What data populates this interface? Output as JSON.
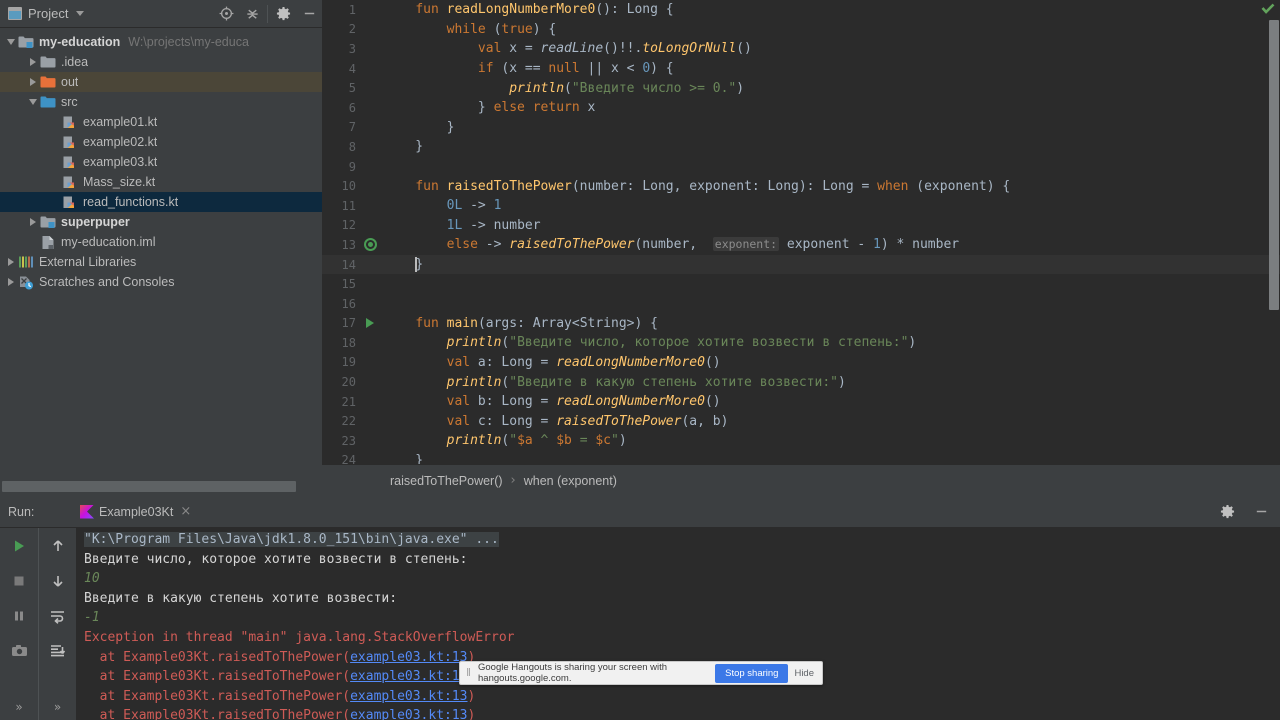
{
  "project_panel": {
    "title": "Project",
    "toolbar": [
      {
        "name": "locate-icon",
        "label": "Select Opened File"
      },
      {
        "name": "collapse-all-icon",
        "label": "Collapse All"
      },
      {
        "name": "gear-icon",
        "label": "Settings"
      },
      {
        "name": "minimize-icon",
        "label": "Hide"
      }
    ],
    "tree": [
      {
        "label": "my-education",
        "path": "W:\\projects\\my-educa",
        "indent": 0,
        "arrow": "down",
        "icon": "module-folder-icon",
        "bold": true,
        "state": "normal"
      },
      {
        "label": ".idea",
        "path": "",
        "indent": 1,
        "arrow": "right",
        "icon": "folder-icon-grey",
        "bold": false,
        "state": "normal"
      },
      {
        "label": "out",
        "path": "",
        "indent": 1,
        "arrow": "right",
        "icon": "folder-icon-orange",
        "bold": false,
        "state": "highlight"
      },
      {
        "label": "src",
        "path": "",
        "indent": 1,
        "arrow": "down",
        "icon": "folder-icon-blue",
        "bold": false,
        "state": "normal"
      },
      {
        "label": "example01.kt",
        "path": "",
        "indent": 2,
        "arrow": "none",
        "icon": "kotlin-file-icon",
        "bold": false,
        "state": "normal"
      },
      {
        "label": "example02.kt",
        "path": "",
        "indent": 2,
        "arrow": "none",
        "icon": "kotlin-file-icon",
        "bold": false,
        "state": "normal"
      },
      {
        "label": "example03.kt",
        "path": "",
        "indent": 2,
        "arrow": "none",
        "icon": "kotlin-file-icon",
        "bold": false,
        "state": "normal"
      },
      {
        "label": "Mass_size.kt",
        "path": "",
        "indent": 2,
        "arrow": "none",
        "icon": "kotlin-file-icon",
        "bold": false,
        "state": "normal"
      },
      {
        "label": "read_functions.kt",
        "path": "",
        "indent": 2,
        "arrow": "none",
        "icon": "kotlin-file-icon",
        "bold": false,
        "state": "selected"
      },
      {
        "label": "superpuper",
        "path": "",
        "indent": 1,
        "arrow": "right",
        "icon": "module-folder-icon",
        "bold": true,
        "state": "normal"
      },
      {
        "label": "my-education.iml",
        "path": "",
        "indent": 1,
        "arrow": "none",
        "icon": "iml-file-icon",
        "bold": false,
        "state": "normal"
      },
      {
        "label": "External Libraries",
        "path": "",
        "indent": 0,
        "arrow": "right",
        "icon": "libraries-icon",
        "bold": false,
        "state": "normal"
      },
      {
        "label": "Scratches and Consoles",
        "path": "",
        "indent": 0,
        "arrow": "right",
        "icon": "scratches-icon",
        "bold": false,
        "state": "normal"
      }
    ]
  },
  "editor": {
    "inspection_status": "ok-check-icon",
    "breadcrumb": [
      "raisedToThePower()",
      "when (exponent)"
    ],
    "breadcrumb_separator": "›",
    "lines": [
      {
        "n": "1",
        "gutter": "",
        "tokens": [
          {
            "t": "    ",
            "c": "pun"
          },
          {
            "t": "fun ",
            "c": "kw"
          },
          {
            "t": "readLongNumberMore0",
            "c": "fn"
          },
          {
            "t": "(): ",
            "c": "pun"
          },
          {
            "t": "Long",
            "c": "typ"
          },
          {
            "t": " {",
            "c": "pun"
          }
        ]
      },
      {
        "n": "2",
        "gutter": "",
        "tokens": [
          {
            "t": "        ",
            "c": "pun"
          },
          {
            "t": "while",
            "c": "kw"
          },
          {
            "t": " (",
            "c": "pun"
          },
          {
            "t": "true",
            "c": "kw"
          },
          {
            "t": ") {",
            "c": "pun"
          }
        ]
      },
      {
        "n": "3",
        "gutter": "",
        "tokens": [
          {
            "t": "            ",
            "c": "pun"
          },
          {
            "t": "val",
            "c": "kw"
          },
          {
            "t": " x = ",
            "c": "id"
          },
          {
            "t": "readLine",
            "c": "idi"
          },
          {
            "t": "()!!.",
            "c": "pun"
          },
          {
            "t": "toLongOrNull",
            "c": "fni"
          },
          {
            "t": "()",
            "c": "pun"
          }
        ]
      },
      {
        "n": "4",
        "gutter": "",
        "tokens": [
          {
            "t": "            ",
            "c": "pun"
          },
          {
            "t": "if",
            "c": "kw"
          },
          {
            "t": " (x == ",
            "c": "id"
          },
          {
            "t": "null",
            "c": "kw"
          },
          {
            "t": " || x < ",
            "c": "id"
          },
          {
            "t": "0",
            "c": "num"
          },
          {
            "t": ") {",
            "c": "pun"
          }
        ]
      },
      {
        "n": "5",
        "gutter": "",
        "tokens": [
          {
            "t": "                ",
            "c": "pun"
          },
          {
            "t": "println",
            "c": "fni"
          },
          {
            "t": "(",
            "c": "pun"
          },
          {
            "t": "\"Введите число >= 0.\"",
            "c": "str"
          },
          {
            "t": ")",
            "c": "pun"
          }
        ]
      },
      {
        "n": "6",
        "gutter": "",
        "tokens": [
          {
            "t": "            } ",
            "c": "pun"
          },
          {
            "t": "else return",
            "c": "kw"
          },
          {
            "t": " x",
            "c": "id"
          }
        ]
      },
      {
        "n": "7",
        "gutter": "",
        "tokens": [
          {
            "t": "        }",
            "c": "pun"
          }
        ]
      },
      {
        "n": "8",
        "gutter": "",
        "tokens": [
          {
            "t": "    }",
            "c": "pun"
          }
        ]
      },
      {
        "n": "9",
        "gutter": "",
        "tokens": []
      },
      {
        "n": "10",
        "gutter": "",
        "tokens": [
          {
            "t": "    ",
            "c": "pun"
          },
          {
            "t": "fun ",
            "c": "kw"
          },
          {
            "t": "raisedToThePower",
            "c": "fn"
          },
          {
            "t": "(number: ",
            "c": "id"
          },
          {
            "t": "Long",
            "c": "typ"
          },
          {
            "t": ", exponent: ",
            "c": "id"
          },
          {
            "t": "Long",
            "c": "typ"
          },
          {
            "t": "): ",
            "c": "pun"
          },
          {
            "t": "Long",
            "c": "typ"
          },
          {
            "t": " = ",
            "c": "pun"
          },
          {
            "t": "when",
            "c": "kw"
          },
          {
            "t": " (exponent) {",
            "c": "id"
          }
        ]
      },
      {
        "n": "11",
        "gutter": "",
        "tokens": [
          {
            "t": "        ",
            "c": "pun"
          },
          {
            "t": "0L",
            "c": "num"
          },
          {
            "t": " -> ",
            "c": "pun"
          },
          {
            "t": "1",
            "c": "num"
          }
        ]
      },
      {
        "n": "12",
        "gutter": "",
        "tokens": [
          {
            "t": "        ",
            "c": "pun"
          },
          {
            "t": "1L",
            "c": "num"
          },
          {
            "t": " -> number",
            "c": "id"
          }
        ]
      },
      {
        "n": "13",
        "gutter": "recursion-icon",
        "tokens": [
          {
            "t": "        ",
            "c": "pun"
          },
          {
            "t": "else",
            "c": "kw"
          },
          {
            "t": " -> ",
            "c": "pun"
          },
          {
            "t": "raisedToThePower",
            "c": "fni"
          },
          {
            "t": "(number,  ",
            "c": "id"
          },
          {
            "t": "exponent:",
            "c": "hint"
          },
          {
            "t": " exponent - ",
            "c": "id"
          },
          {
            "t": "1",
            "c": "num"
          },
          {
            "t": ") * number",
            "c": "id"
          }
        ]
      },
      {
        "n": "14",
        "gutter": "",
        "tokens": [
          {
            "t": "    ",
            "c": "pun"
          },
          {
            "t": "CARET",
            "c": "caret"
          },
          {
            "t": "}",
            "c": "pun"
          }
        ],
        "current": true
      },
      {
        "n": "15",
        "gutter": "",
        "tokens": []
      },
      {
        "n": "16",
        "gutter": "",
        "tokens": []
      },
      {
        "n": "17",
        "gutter": "run-icon",
        "tokens": [
          {
            "t": "    ",
            "c": "pun"
          },
          {
            "t": "fun ",
            "c": "kw"
          },
          {
            "t": "main",
            "c": "fn"
          },
          {
            "t": "(args: ",
            "c": "id"
          },
          {
            "t": "Array",
            "c": "typ"
          },
          {
            "t": "<",
            "c": "pun"
          },
          {
            "t": "String",
            "c": "typ"
          },
          {
            "t": ">) {",
            "c": "pun"
          }
        ]
      },
      {
        "n": "18",
        "gutter": "",
        "tokens": [
          {
            "t": "        ",
            "c": "pun"
          },
          {
            "t": "println",
            "c": "fni"
          },
          {
            "t": "(",
            "c": "pun"
          },
          {
            "t": "\"Введите число, которое хотите возвести в степень:\"",
            "c": "str"
          },
          {
            "t": ")",
            "c": "pun"
          }
        ]
      },
      {
        "n": "19",
        "gutter": "",
        "tokens": [
          {
            "t": "        ",
            "c": "pun"
          },
          {
            "t": "val",
            "c": "kw"
          },
          {
            "t": " a: ",
            "c": "id"
          },
          {
            "t": "Long",
            "c": "typ"
          },
          {
            "t": " = ",
            "c": "pun"
          },
          {
            "t": "readLongNumberMore0",
            "c": "fni"
          },
          {
            "t": "()",
            "c": "pun"
          }
        ]
      },
      {
        "n": "20",
        "gutter": "",
        "tokens": [
          {
            "t": "        ",
            "c": "pun"
          },
          {
            "t": "println",
            "c": "fni"
          },
          {
            "t": "(",
            "c": "pun"
          },
          {
            "t": "\"Введите в какую степень хотите возвести:\"",
            "c": "str"
          },
          {
            "t": ")",
            "c": "pun"
          }
        ]
      },
      {
        "n": "21",
        "gutter": "",
        "tokens": [
          {
            "t": "        ",
            "c": "pun"
          },
          {
            "t": "val",
            "c": "kw"
          },
          {
            "t": " b: ",
            "c": "id"
          },
          {
            "t": "Long",
            "c": "typ"
          },
          {
            "t": " = ",
            "c": "pun"
          },
          {
            "t": "readLongNumberMore0",
            "c": "fni"
          },
          {
            "t": "()",
            "c": "pun"
          }
        ]
      },
      {
        "n": "22",
        "gutter": "",
        "tokens": [
          {
            "t": "        ",
            "c": "pun"
          },
          {
            "t": "val",
            "c": "kw"
          },
          {
            "t": " c: ",
            "c": "id"
          },
          {
            "t": "Long",
            "c": "typ"
          },
          {
            "t": " = ",
            "c": "pun"
          },
          {
            "t": "raisedToThePower",
            "c": "fni"
          },
          {
            "t": "(a, b)",
            "c": "id"
          }
        ]
      },
      {
        "n": "23",
        "gutter": "",
        "tokens": [
          {
            "t": "        ",
            "c": "pun"
          },
          {
            "t": "println",
            "c": "fni"
          },
          {
            "t": "(",
            "c": "pun"
          },
          {
            "t": "\"",
            "c": "str"
          },
          {
            "t": "$a",
            "c": "kw"
          },
          {
            "t": " ^ ",
            "c": "str"
          },
          {
            "t": "$b",
            "c": "kw"
          },
          {
            "t": " = ",
            "c": "str"
          },
          {
            "t": "$c",
            "c": "kw"
          },
          {
            "t": "\"",
            "c": "str"
          },
          {
            "t": ")",
            "c": "pun"
          }
        ]
      },
      {
        "n": "24",
        "gutter": "",
        "tokens": [
          {
            "t": "    }",
            "c": "pun"
          }
        ]
      }
    ]
  },
  "run_panel": {
    "label": "Run:",
    "tab": "Example03Kt",
    "tab_close": "×",
    "header_buttons": [
      {
        "name": "gear-icon",
        "label": "Settings"
      },
      {
        "name": "minimize-icon",
        "label": "Hide"
      }
    ],
    "toolbar_col1": [
      {
        "name": "rerun-icon",
        "label": "Rerun"
      },
      {
        "name": "stop-icon",
        "label": "Stop"
      },
      {
        "name": "pause-icon",
        "label": "Pause Output"
      },
      {
        "name": "camera-icon",
        "label": "Dump Threads"
      }
    ],
    "toolbar_col2": [
      {
        "name": "up-arrow-icon",
        "label": "Up the Stack Trace"
      },
      {
        "name": "down-arrow-icon",
        "label": "Down the Stack Trace"
      },
      {
        "name": "soft-wrap-icon",
        "label": "Use Soft Wraps"
      },
      {
        "name": "scroll-to-end-icon",
        "label": "Scroll to End"
      }
    ],
    "expand_chevrons": "»",
    "console": [
      {
        "text": "\"K:\\Program Files\\Java\\jdk1.8.0_151\\bin\\java.exe\" ...",
        "kind": "cmd"
      },
      {
        "text": "Введите число, которое хотите возвести в степень:",
        "kind": "out"
      },
      {
        "text": "10",
        "kind": "in"
      },
      {
        "text": "Введите в какую степень хотите возвести:",
        "kind": "out"
      },
      {
        "text": "-1",
        "kind": "in"
      },
      {
        "text": "Exception in thread \"main\" java.lang.StackOverflowError",
        "kind": "err"
      },
      {
        "pre": "  at Example03Kt.raisedToThePower(",
        "link": "example03.kt:13",
        "post": ")",
        "kind": "trace"
      },
      {
        "pre": "  at Example03Kt.raisedToThePower(",
        "link": "example03.kt:13",
        "post": ")",
        "kind": "trace"
      },
      {
        "pre": "  at Example03Kt.raisedToThePower(",
        "link": "example03.kt:13",
        "post": ")",
        "kind": "trace"
      },
      {
        "pre": "  at Example03Kt.raisedToThePower(",
        "link": "example03.kt:13",
        "post": ")",
        "kind": "trace"
      }
    ]
  },
  "hangouts": {
    "grip": "‖",
    "message": "Google Hangouts is sharing your screen with hangouts.google.com.",
    "stop_label": "Stop sharing",
    "hide_label": "Hide"
  },
  "colors": {
    "panel_bg": "#3c3f41",
    "editor_bg": "#2b2b2b",
    "selection_blue": "#0d293e",
    "highlight_olive": "#4b4638",
    "keyword_orange": "#cc7832",
    "function_yellow": "#ffc66d",
    "string_green": "#6a8759",
    "number_blue": "#6897bb",
    "error_red": "#cf5b56",
    "link_blue": "#548af7",
    "accent_blue": "#3b78e7"
  }
}
